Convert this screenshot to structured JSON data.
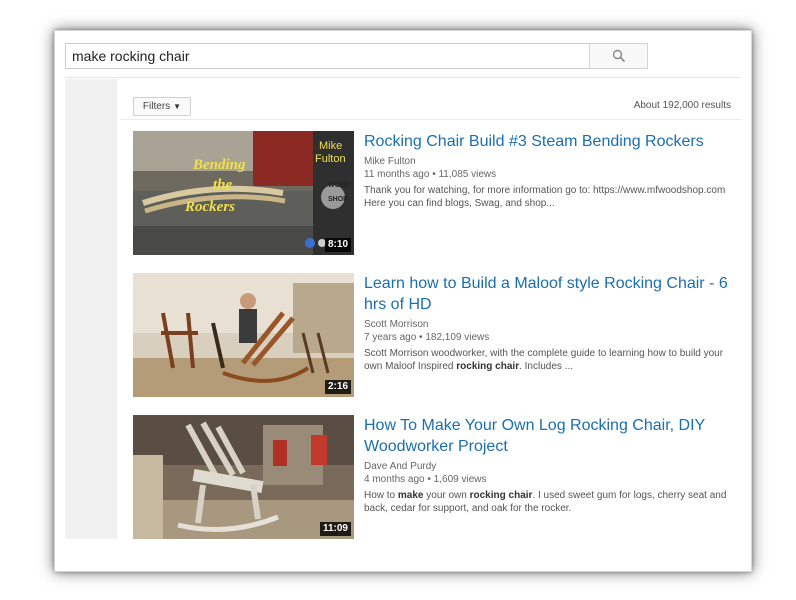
{
  "search": {
    "query": "make rocking chair"
  },
  "toolbar": {
    "filters_label": "Filters",
    "results_count": "About 192,000 results"
  },
  "icons": {
    "search": "search-icon",
    "caret": "caret-down-icon",
    "play": "play-icon",
    "clock": "watch-later-icon"
  },
  "colors": {
    "link": "#1a6fb0",
    "meta": "#666666"
  },
  "results": [
    {
      "title": "Rocking Chair Build #3 Steam Bending Rockers",
      "channel": "Mike Fulton",
      "age": "11 months ago",
      "views": "11,085 views",
      "description": "Thank you for watching, for more information go to: https://www.mfwoodshop.com Here you can find blogs, Swag, and shop...",
      "duration": "8:10",
      "thumb_text": {
        "line1": "Bending",
        "line2": "the",
        "line3": "Rockers",
        "brand1": "Mike",
        "brand2": "Fulton",
        "brand3": "WOOD",
        "brand4": "SHOP"
      }
    },
    {
      "title": "Learn how to Build a Maloof style Rocking Chair - 6 hrs of HD",
      "channel": "Scott Morrison",
      "age": "7 years ago",
      "views": "182,109 views",
      "desc_before": "Scott Morrison woodworker, with the complete guide to learning how to build your own Maloof Inspired ",
      "desc_bold": "rocking chair",
      "desc_after": ". Includes ...",
      "duration": "2:16"
    },
    {
      "title": "How To Make Your Own Log Rocking Chair, DIY Woodworker Project",
      "channel": "Dave And Purdy",
      "age": "4 months ago",
      "views": "1,609 views",
      "desc_p1": "How to ",
      "desc_b1": "make",
      "desc_p2": " your own ",
      "desc_b2": "rocking chair",
      "desc_p3": ". I used sweet gum for logs, cherry seat and back, cedar for support, and oak for the rocker.",
      "duration": "11:09"
    }
  ]
}
